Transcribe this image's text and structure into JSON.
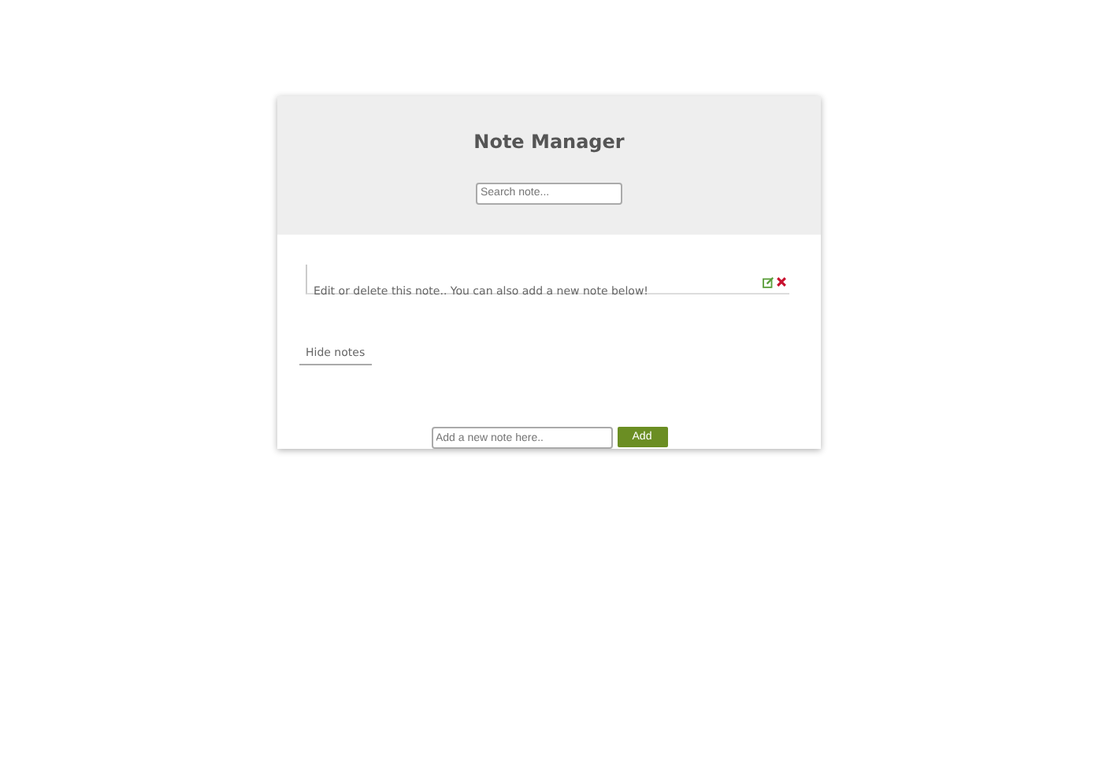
{
  "title": "Note Manager",
  "search": {
    "placeholder": "Search note..."
  },
  "notes": [
    {
      "text": "Edit or delete this note.. You can also add a new note below!"
    }
  ],
  "toggle": "Hide notes",
  "new_note": {
    "placeholder": "Add a new note here..",
    "button": "Add"
  }
}
